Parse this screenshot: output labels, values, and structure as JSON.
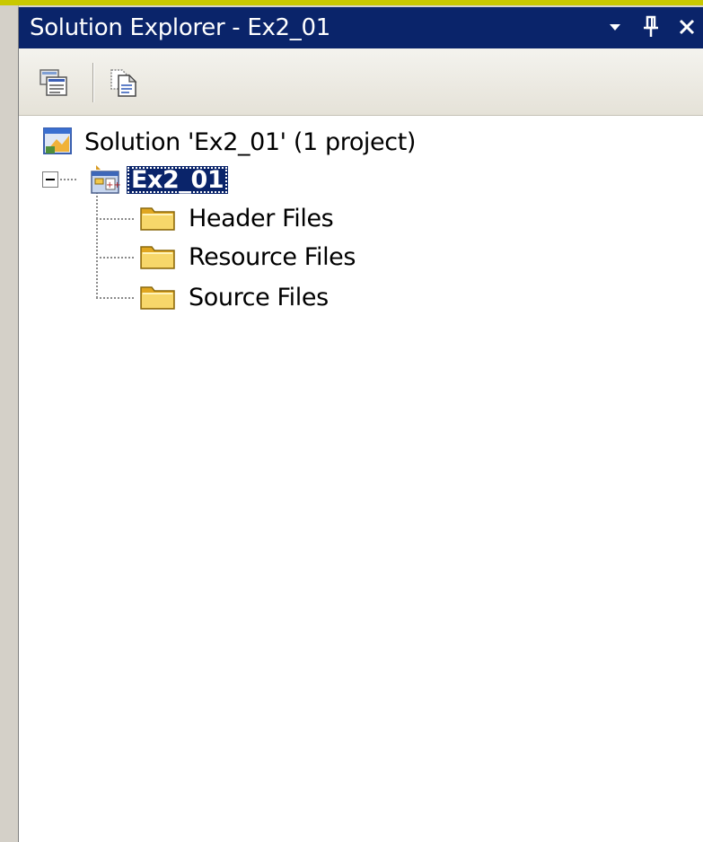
{
  "window": {
    "title": "Solution Explorer - Ex2_01"
  },
  "titlebar_buttons": [
    {
      "name": "window-position-dropdown",
      "icon": "dropdown-arrow-icon"
    },
    {
      "name": "auto-hide-pin",
      "icon": "pin-icon"
    },
    {
      "name": "close",
      "icon": "close-icon"
    }
  ],
  "toolbar": [
    {
      "name": "properties",
      "icon": "properties-icon"
    },
    {
      "name": "show-all-files",
      "icon": "show-all-files-icon"
    }
  ],
  "tree": {
    "solution": {
      "label": "Solution 'Ex2_01' (1 project)",
      "icon": "solution-icon"
    },
    "project": {
      "label": "Ex2_01",
      "icon": "cpp-project-icon",
      "expanded": true,
      "selected": true
    },
    "folders": [
      {
        "label": "Header Files",
        "icon": "folder-icon"
      },
      {
        "label": "Resource Files",
        "icon": "folder-icon"
      },
      {
        "label": "Source Files",
        "icon": "folder-icon"
      }
    ]
  },
  "colors": {
    "title_bg": "#0a246a",
    "selection_bg": "#0a246a",
    "folder_fill": "#f2c84b"
  }
}
